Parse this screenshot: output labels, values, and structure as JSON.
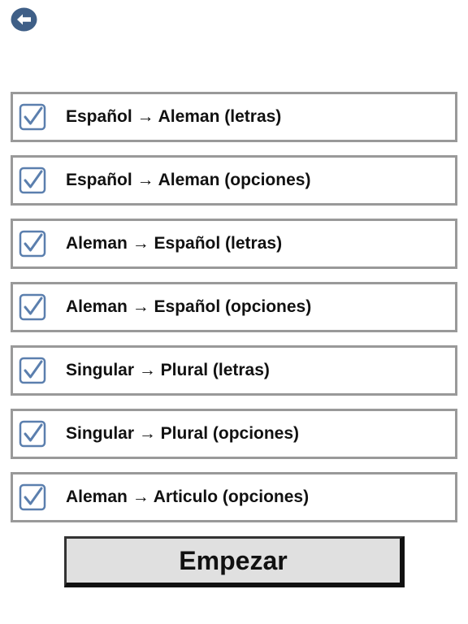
{
  "header": {
    "back_icon": "arrow-left-circle-icon",
    "back_color": "#3f5f87"
  },
  "options": [
    {
      "label": "Español → Aleman (letras)",
      "checked": true
    },
    {
      "label": "Español → Aleman (opciones)",
      "checked": true
    },
    {
      "label": "Aleman → Español (letras)",
      "checked": true
    },
    {
      "label": "Aleman → Español (opciones)",
      "checked": true
    },
    {
      "label": "Singular → Plural (letras)",
      "checked": true
    },
    {
      "label": "Singular → Plural (opciones)",
      "checked": true
    },
    {
      "label": "Aleman → Articulo (opciones)",
      "checked": true
    }
  ],
  "checkbox_color": "#5b7fae",
  "start_button": {
    "label": "Empezar"
  }
}
